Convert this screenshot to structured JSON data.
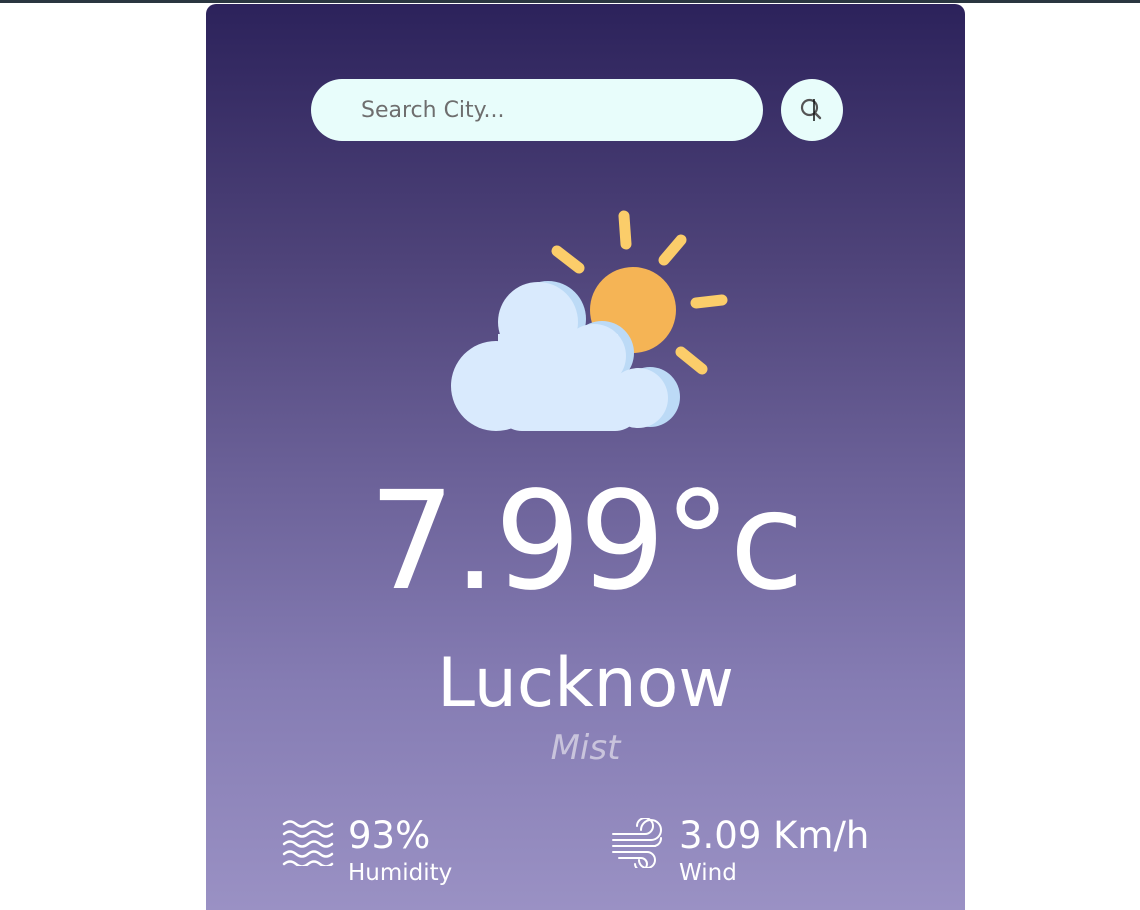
{
  "search": {
    "placeholder": "Search City...",
    "button_icon": "search-icon"
  },
  "weather": {
    "icon": "partly-cloudy-icon",
    "temperature": "7.99°c",
    "city": "Lucknow",
    "condition": "Mist"
  },
  "details": {
    "humidity": {
      "icon": "humidity-icon",
      "value": "93%",
      "label": "Humidity"
    },
    "wind": {
      "icon": "wind-icon",
      "value": "3.09 Km/h",
      "label": "Wind"
    }
  },
  "colors": {
    "gradient_top": "#2c225b",
    "gradient_bottom": "#9a91c4",
    "input_bg": "#e8fdfb",
    "sun": "#f5b455",
    "sun_rays": "#fbcd6a",
    "cloud": "#d9eafd"
  }
}
